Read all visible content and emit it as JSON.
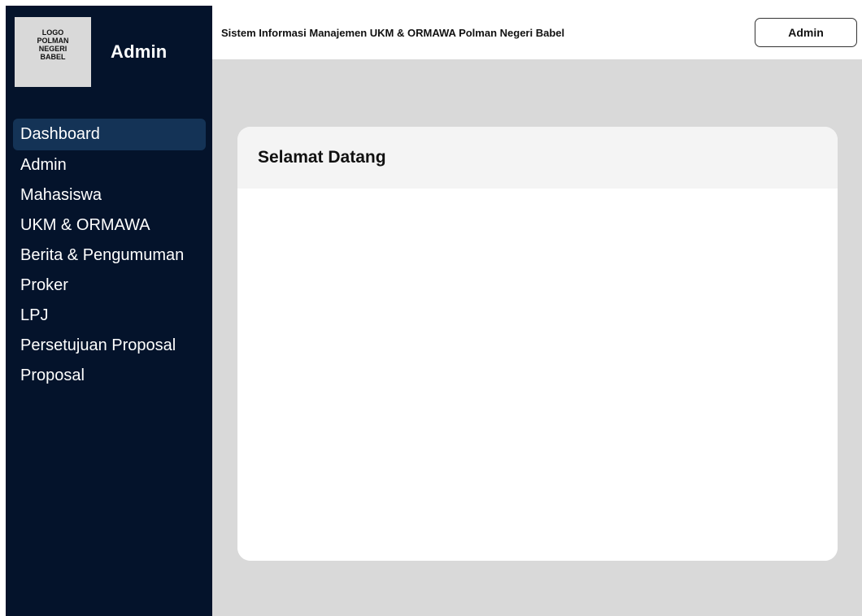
{
  "sidebar": {
    "logo_text": "LOGO POLMAN NEGERI BABEL",
    "title": "Admin",
    "items": [
      {
        "label": "Dashboard",
        "active": true
      },
      {
        "label": "Admin"
      },
      {
        "label": "Mahasiswa"
      },
      {
        "label": "UKM & ORMAWA"
      },
      {
        "label": "Berita & Pengumuman"
      },
      {
        "label": "Proker"
      },
      {
        "label": "LPJ"
      },
      {
        "label": "Persetujuan Proposal"
      },
      {
        "label": "Proposal"
      }
    ]
  },
  "header": {
    "title": "Sistem Informasi Manajemen UKM & ORMAWA Polman Negeri Babel",
    "user_label": "Admin"
  },
  "main": {
    "card_title": "Selamat Datang"
  },
  "colors": {
    "sidebar_bg": "#04132b",
    "sidebar_active": "#143356",
    "content_bg": "#d9d9d9",
    "card_header_bg": "#f4f4f4"
  }
}
